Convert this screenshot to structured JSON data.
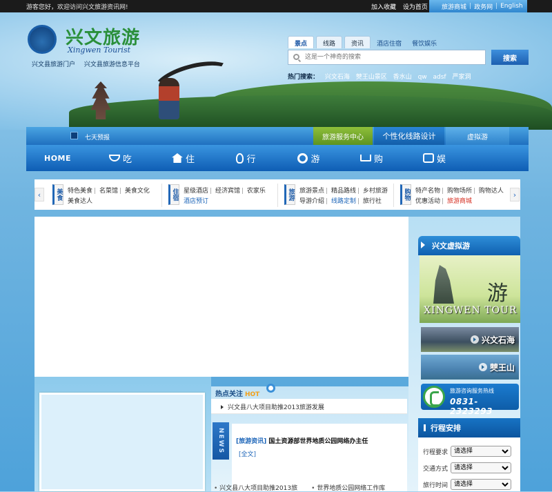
{
  "topbar": {
    "welcome": "游客您好，欢迎访问兴文旅游资讯网!",
    "favorite": "加入收藏",
    "homepage": "设为首页",
    "lang_links": [
      "旅游商城",
      "政务网",
      "English"
    ]
  },
  "header": {
    "logo_cn": "兴文旅游",
    "logo_en": "Xingwen Tourist",
    "portal_links": [
      "兴文县旅游门户",
      "兴文县旅游信息平台"
    ]
  },
  "search": {
    "tabs": [
      "景点",
      "线路",
      "资讯"
    ],
    "extra_tabs": [
      "酒店住宿",
      "餐饮娱乐"
    ],
    "placeholder": "这是一个神奇的搜索",
    "button": "搜索",
    "hot_label": "热门搜索：",
    "hot_terms": [
      "兴文石海",
      "僰王山景区",
      "香水山",
      "qw",
      "adsf",
      "严家洞"
    ]
  },
  "subbar": {
    "forecast": "七天预报",
    "tabs": [
      "旅游服务中心",
      "个性化线路设计",
      "虚拟游"
    ]
  },
  "nav": {
    "home": "HOME",
    "items": [
      "吃",
      "住",
      "行",
      "游",
      "购",
      "娱"
    ]
  },
  "categories": [
    {
      "badge": "美食",
      "line1": [
        "特色美食",
        "名菜馆",
        "美食文化"
      ],
      "line2": [
        "美食达人"
      ]
    },
    {
      "badge": "住宿",
      "line1": [
        "星级酒店",
        "经济宾馆",
        "农家乐"
      ],
      "line2": [
        "酒店预订"
      ]
    },
    {
      "badge": "旅游",
      "line1": [
        "旅游景点",
        "精品路线",
        "乡村旅游"
      ],
      "line2": [
        "导游介绍",
        "线路定制",
        "旅行社"
      ]
    },
    {
      "badge": "购物",
      "line1": [
        "特产名物",
        "购物场所",
        "购物达人"
      ],
      "line2": [
        "优惠活动",
        "旅游商城"
      ]
    }
  ],
  "hot_focus": {
    "title": "热点关注",
    "hot": "HOT",
    "item": "兴文县八大项目助推2013旅游发展"
  },
  "news": {
    "tag": "NEWS",
    "category": "[旅游资讯]",
    "title": "国土资源部世界地质公园网络办主任",
    "full": "[全文]",
    "list": [
      "兴文县八大项目助推2013旅",
      "世界地质公园网络工作库"
    ]
  },
  "sidebar": {
    "virtual_title": "兴文虚拟游",
    "tour_en": "XINGWEN TOUR",
    "tour_script": "游",
    "spots": [
      "兴文石海",
      "僰王山"
    ],
    "hotline_label": "旅游咨询服务热线",
    "hotline_number": "0831-2323293",
    "itinerary_title": "行程安排",
    "itinerary": [
      {
        "label": "行程要求",
        "value": "请选择"
      },
      {
        "label": "交通方式",
        "value": "请选择"
      },
      {
        "label": "旅行时间",
        "value": "请选择"
      }
    ]
  }
}
